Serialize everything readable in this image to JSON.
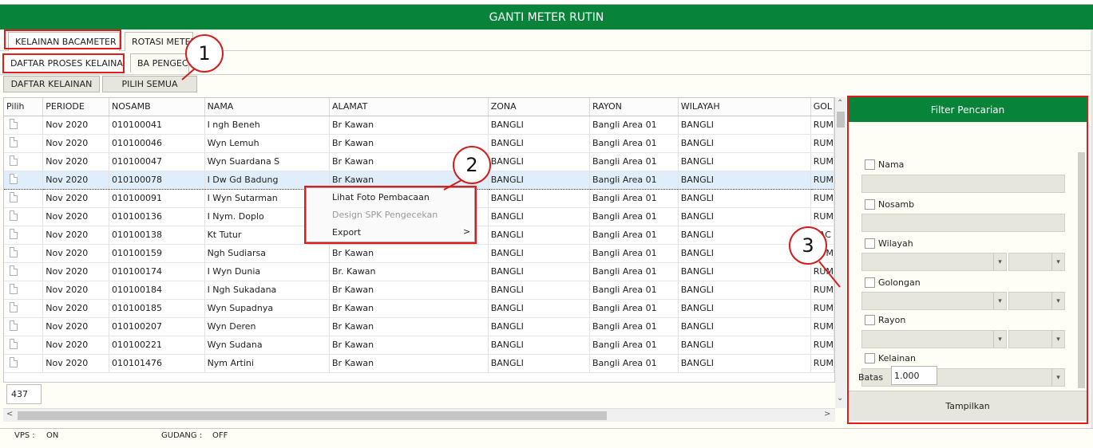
{
  "window": {
    "title": "GANTI METER RUTIN"
  },
  "tabs_top": [
    {
      "label": "KELAINAN BACAMETER",
      "active": true
    },
    {
      "label": "ROTASI METER",
      "active": false
    }
  ],
  "tabs_sub": [
    {
      "label": "DAFTAR PROSES KELAINAN",
      "active": true
    },
    {
      "label": "BA PENGECEKAN",
      "active": false
    }
  ],
  "toolbar": {
    "daftar_kelainan_label": "DAFTAR KELAINAN",
    "pilih_semua_label": "PILIH SEMUA"
  },
  "callouts": [
    "1",
    "2",
    "3"
  ],
  "table": {
    "columns": [
      "Pilih",
      "PERIODE",
      "NOSAMB",
      "NAMA",
      "ALAMAT",
      "ZONA",
      "RAYON",
      "WILAYAH",
      "GOL"
    ],
    "rows": [
      [
        "",
        "Nov 2020",
        "010100041",
        "I ngh Beneh",
        "Br Kawan",
        "BANGLI",
        "Bangli Area 01",
        "BANGLI",
        "RUM"
      ],
      [
        "",
        "Nov 2020",
        "010100046",
        "Wyn Lemuh",
        "Br Kawan",
        "BANGLI",
        "Bangli Area 01",
        "BANGLI",
        "RUM"
      ],
      [
        "",
        "Nov 2020",
        "010100047",
        "Wyn Suardana S",
        "Br Kawan",
        "BANGLI",
        "Bangli Area 01",
        "BANGLI",
        "RUM"
      ],
      [
        "",
        "Nov 2020",
        "010100078",
        "I Dw Gd Badung",
        "Br Kawan",
        "BANGLI",
        "Bangli Area 01",
        "BANGLI",
        "RUM"
      ],
      [
        "",
        "Nov 2020",
        "010100091",
        "I Wyn Sutarman",
        "",
        "BANGLI",
        "Bangli Area 01",
        "BANGLI",
        "RUM"
      ],
      [
        "",
        "Nov 2020",
        "010100136",
        "I Nym. Doplo",
        "",
        "BANGLI",
        "Bangli Area 01",
        "BANGLI",
        "RUM"
      ],
      [
        "",
        "Nov 2020",
        "010100138",
        "Kt Tutur",
        "",
        "BANGLI",
        "Bangli Area 01",
        "BANGLI",
        "SAC"
      ],
      [
        "",
        "Nov 2020",
        "010100159",
        "Ngh Sudiarsa",
        "Br Kawan",
        "BANGLI",
        "Bangli Area 01",
        "BANGLI",
        "RUM"
      ],
      [
        "",
        "Nov 2020",
        "010100174",
        "I Wyn Dunia",
        "Br. Kawan",
        "BANGLI",
        "Bangli Area 01",
        "BANGLI",
        "RUM"
      ],
      [
        "",
        "Nov 2020",
        "010100184",
        "I Ngh Sukadana",
        "Br Kawan",
        "BANGLI",
        "Bangli Area 01",
        "BANGLI",
        "RUM"
      ],
      [
        "",
        "Nov 2020",
        "010100185",
        "Wyn Supadnya",
        "Br Kawan",
        "BANGLI",
        "Bangli Area 01",
        "BANGLI",
        "RUM"
      ],
      [
        "",
        "Nov 2020",
        "010100207",
        "Wyn Deren",
        "Br Kawan",
        "BANGLI",
        "Bangli Area 01",
        "BANGLI",
        "RUM"
      ],
      [
        "",
        "Nov 2020",
        "010100221",
        "Wyn Sudana",
        "Br Kawan",
        "BANGLI",
        "Bangli Area 01",
        "BANGLI",
        "RUM"
      ],
      [
        "",
        "Nov 2020",
        "010101476",
        "Nym Artini",
        "Br Kawan",
        "BANGLI",
        "Bangli Area 01",
        "BANGLI",
        "RUM"
      ]
    ],
    "selected_row": 3,
    "record_count": "437"
  },
  "context_menu": {
    "items": [
      {
        "label": "Lihat Foto Pembacaan",
        "enabled": true
      },
      {
        "label": "Design SPK Pengecekan",
        "enabled": false
      },
      {
        "label": "Export",
        "enabled": true,
        "submenu_arrow": ">"
      }
    ]
  },
  "filter": {
    "title": "Filter Pencarian",
    "nama_label": "Nama",
    "nosamb_label": "Nosamb",
    "wilayah_label": "Wilayah",
    "golongan_label": "Golongan",
    "rayon_label": "Rayon",
    "kelainan_label": "Kelainan",
    "batas_label": "Batas",
    "batas_value": "1.000",
    "tampilkan_label": "Tampilkan"
  },
  "status": {
    "vps_label": "VPS :",
    "vps_value": "ON",
    "gudang_label": "GUDANG :",
    "gudang_value": "OFF"
  },
  "colors": {
    "header_green": "#07843a",
    "highlight_red": "#e21b1b",
    "selected_row": "#dfeefa"
  }
}
